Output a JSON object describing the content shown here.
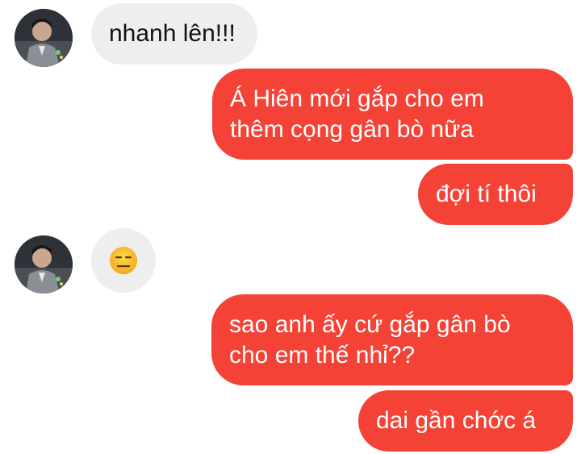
{
  "conversation": {
    "messages": [
      {
        "sender": "other",
        "type": "text",
        "text": "nhanh lên!!!"
      },
      {
        "sender": "me",
        "type": "text",
        "text": "Á Hiên mới gắp cho em thêm cọng gân bò nữa"
      },
      {
        "sender": "me",
        "type": "text",
        "text": "đợi tí thôi"
      },
      {
        "sender": "other",
        "type": "emoji",
        "icon": "expressionless-face-icon"
      },
      {
        "sender": "me",
        "type": "text",
        "text": "sao anh ấy cứ gắp gân bò cho em thế nhỉ??"
      },
      {
        "sender": "me",
        "type": "text",
        "text": "dai gần chớc á"
      }
    ]
  },
  "colors": {
    "outgoing_bubble": "#f44336",
    "incoming_bubble": "#eeeeee",
    "outgoing_text": "#ffffff",
    "incoming_text": "#111111",
    "background": "#ffffff"
  }
}
